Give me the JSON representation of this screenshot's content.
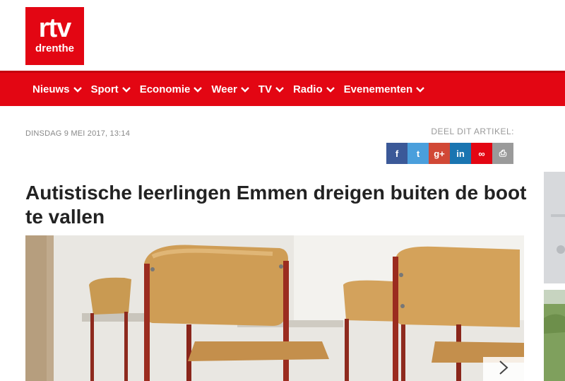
{
  "brand": {
    "line1": "rtv",
    "line2": "drenthe",
    "color": "#e30613"
  },
  "nav": {
    "items": [
      {
        "label": "Nieuws"
      },
      {
        "label": "Sport"
      },
      {
        "label": "Economie"
      },
      {
        "label": "Weer"
      },
      {
        "label": "TV"
      },
      {
        "label": "Radio"
      },
      {
        "label": "Evenementen"
      }
    ],
    "color": "#e30613"
  },
  "article": {
    "date": "DINSDAG 9 MEI 2017, 13:14",
    "title": "Autistische leerlingen Emmen dreigen buiten de boot te vallen",
    "share_label": "DEEL DIT ARTIKEL:",
    "share_buttons": [
      {
        "icon": "facebook-icon",
        "glyph": "f",
        "color": "#3b5998"
      },
      {
        "icon": "twitter-icon",
        "glyph": "t",
        "color": "#4a9fdc"
      },
      {
        "icon": "google-plus-icon",
        "glyph": "g+",
        "color": "#d14836"
      },
      {
        "icon": "linkedin-icon",
        "glyph": "in",
        "color": "#1a75b1"
      },
      {
        "icon": "link-icon",
        "glyph": "∞",
        "color": "#e30613"
      },
      {
        "icon": "print-icon",
        "glyph": "⎙",
        "color": "#9a9a9a"
      }
    ]
  },
  "hero": {
    "icon": "chevron-right-icon"
  }
}
